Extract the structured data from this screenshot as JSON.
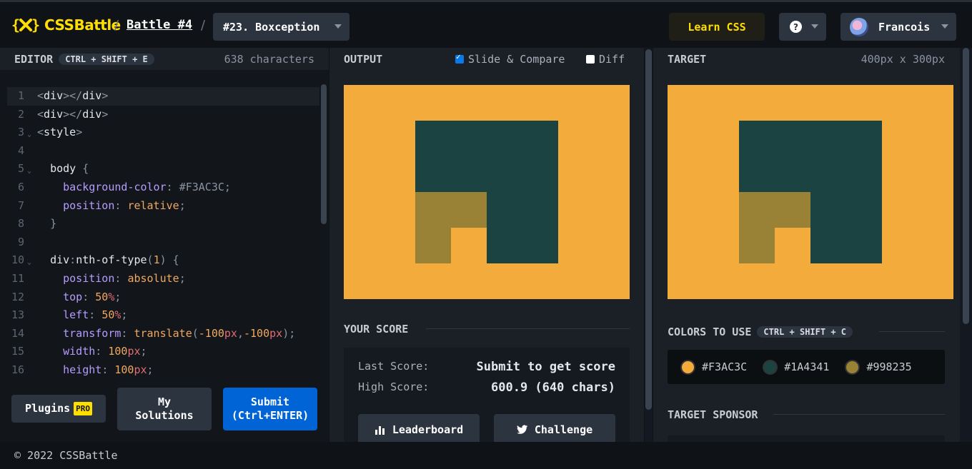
{
  "header": {
    "logo_text": "CSSBattle",
    "battle_label": "Battle #4",
    "level_label": "#23. Boxception",
    "learn_label": "Learn CSS",
    "help_icon": "question-circle-icon",
    "user_name": "Francois"
  },
  "editor": {
    "title": "EDITOR",
    "shortcut": "CTRL + SHIFT + E",
    "char_count": "638 characters",
    "plugins_label": "Plugins",
    "pro_badge": "PRO",
    "my_solutions_label": "My Solutions",
    "submit_label": "Submit",
    "submit_hint": "(Ctrl+ENTER)"
  },
  "output": {
    "title": "OUTPUT",
    "slide_compare_label": "Slide & Compare",
    "slide_compare_checked": true,
    "diff_label": "Diff",
    "diff_checked": false
  },
  "score": {
    "title": "YOUR SCORE",
    "last_label": "Last Score:",
    "last_value": "Submit to get score",
    "high_label": "High Score:",
    "high_value": "600.9 (640 chars)",
    "leaderboard_label": "Leaderboard",
    "challenge_label": "Challenge"
  },
  "target": {
    "title": "TARGET",
    "dimensions": "400px x 300px",
    "colors_title": "COLORS TO USE",
    "colors_shortcut": "CTRL + SHIFT + C",
    "colors": [
      {
        "hex": "#F3AC3C",
        "label": "#F3AC3C"
      },
      {
        "hex": "#1A4341",
        "label": "#1A4341"
      },
      {
        "hex": "#998235",
        "label": "#998235"
      }
    ],
    "sponsor_title": "TARGET SPONSOR"
  },
  "footer": {
    "copyright": "© 2022 CSSBattle"
  }
}
